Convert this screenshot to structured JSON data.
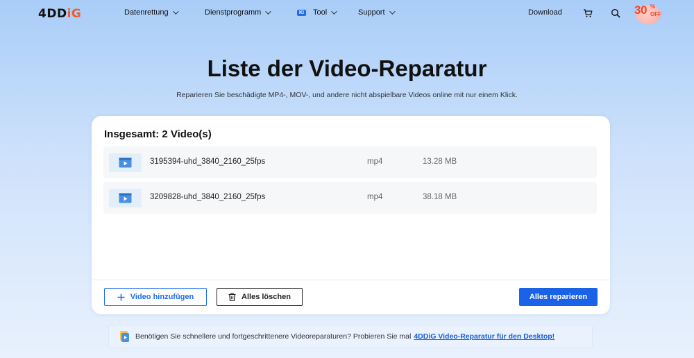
{
  "nav": {
    "logo_main": "4DD",
    "logo_accent": "iG",
    "items": [
      {
        "label": "Datenrettung"
      },
      {
        "label": "Dienstprogramm"
      },
      {
        "label": "Tool",
        "badge": "KI"
      },
      {
        "label": "Support"
      }
    ],
    "download_label": "Download",
    "icons": {
      "cart": "cart-icon",
      "search": "search-icon"
    },
    "promo": {
      "percent": "30",
      "symbol": "%",
      "off": "OFF"
    }
  },
  "hero": {
    "title": "Liste der Video-Reparatur",
    "subtitle": "Reparieren Sie beschädigte MP4-, MOV-, und andere nicht abspielbare Videos online mit nur einem Klick."
  },
  "list": {
    "heading": "Insgesamt: 2 Video(s)",
    "files": [
      {
        "name": "3195394-uhd_3840_2160_25fps",
        "type": "mp4",
        "size": "13.28 MB"
      },
      {
        "name": "3209828-uhd_3840_2160_25fps",
        "type": "mp4",
        "size": "38.18 MB"
      }
    ],
    "add_label": "Video hinzufügen",
    "clear_label": "Alles löschen",
    "repair_label": "Alles reparieren"
  },
  "hint": {
    "text": "Benötigen Sie schnellere und fortgeschrittenere Videoreparaturen? Probieren Sie mal",
    "link": "4DDiG Video-Reparatur für den Desktop!"
  },
  "colors": {
    "accent": "#1b63e6",
    "brand_orange": "#f25c2a",
    "promo_red": "#f0472b"
  }
}
